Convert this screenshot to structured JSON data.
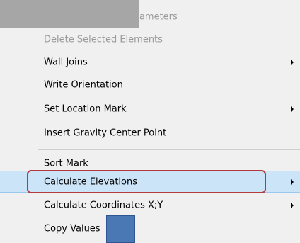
{
  "menu": {
    "items": [
      {
        "label": "Change Selected Parameters",
        "disabled": true,
        "submenu": false
      },
      {
        "label": "Delete Selected Elements",
        "disabled": true,
        "submenu": false
      },
      {
        "label": "Wall Joins",
        "disabled": false,
        "submenu": true
      },
      {
        "label": "Write Orientation",
        "disabled": false,
        "submenu": false
      },
      {
        "label": "Set Location Mark",
        "disabled": false,
        "submenu": true
      },
      {
        "label": "Insert Gravity Center Point",
        "disabled": false,
        "submenu": false
      },
      {
        "label": "Sort Mark",
        "disabled": false,
        "submenu": false
      },
      {
        "label": "Calculate Elevations",
        "disabled": false,
        "submenu": true,
        "selected": true
      },
      {
        "label": "Calculate Coordinates X;Y",
        "disabled": false,
        "submenu": true
      },
      {
        "label": "Copy Values",
        "disabled": false,
        "submenu": false
      }
    ]
  },
  "colors": {
    "menu_background": "#f0f0f0",
    "disabled_text": "#9a9a9a",
    "selected_background": "#cce4f7",
    "highlight_outline": "#b33b3b",
    "overlay_grey": "#a6a6a6",
    "overlay_blue": "#4a78b5"
  }
}
